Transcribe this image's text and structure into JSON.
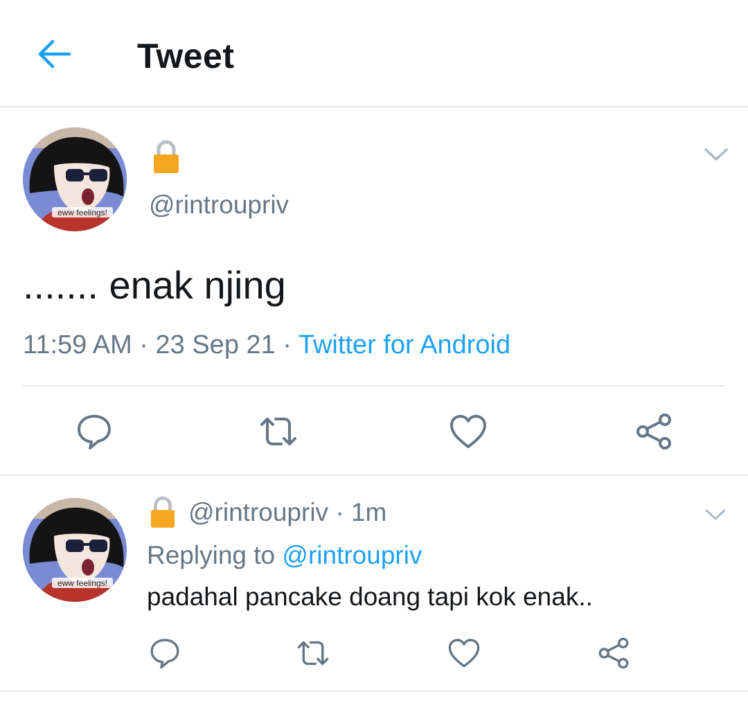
{
  "header": {
    "title": "Tweet",
    "back_icon": "arrow-left-icon",
    "accent_color": "#1da1f2"
  },
  "main_tweet": {
    "avatar_caption": "eww feelings!",
    "lock_icon": "lock-icon",
    "handle": "@rintroupriv",
    "menu_icon": "chevron-down-icon",
    "text": "....... enak njing",
    "time": "11:59 AM",
    "date": "23 Sep 21",
    "separator": " · ",
    "source": "Twitter for Android",
    "actions": [
      "reply-icon",
      "retweet-icon",
      "like-icon",
      "share-icon"
    ]
  },
  "reply_tweet": {
    "avatar_caption": "eww feelings!",
    "lock_icon": "lock-icon",
    "handle": "@rintroupriv",
    "time_ago": "1m",
    "separator": " · ",
    "replying_label": "Replying to",
    "replying_to": "@rintroupriv",
    "text": "padahal pancake doang tapi kok enak..",
    "menu_icon": "chevron-down-icon",
    "actions": [
      "reply-icon",
      "retweet-icon",
      "like-icon",
      "share-icon"
    ]
  },
  "colors": {
    "text_primary": "#14171a",
    "text_secondary": "#657786",
    "link": "#1da1f2",
    "divider": "#e1e8ed",
    "icon": "#657786",
    "lock": "#f5a623"
  }
}
